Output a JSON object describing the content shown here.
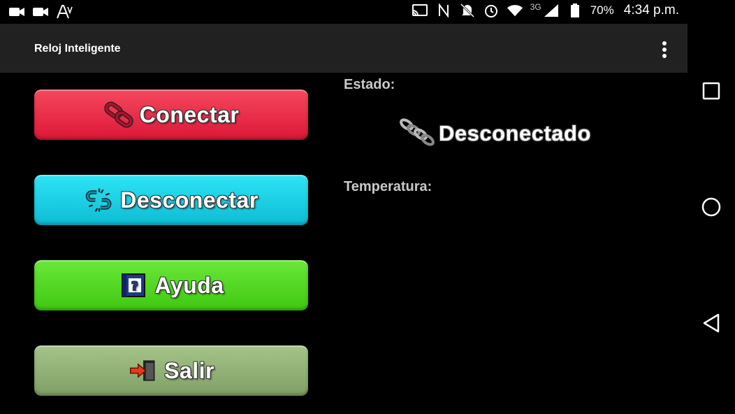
{
  "status_bar": {
    "icons_left": [
      "video-icon",
      "video-icon",
      "text-accessibility-icon"
    ],
    "icons_right": [
      "cast-icon",
      "nfc-icon",
      "mute-icon",
      "alarm-icon",
      "wifi-icon",
      "signal-icon",
      "battery-icon"
    ],
    "network": "3G",
    "battery": "70%",
    "time": "4:34 p.m."
  },
  "app_bar": {
    "title": "Reloj Inteligente"
  },
  "buttons": {
    "conectar": "Conectar",
    "desconectar": "Desconectar",
    "ayuda": "Ayuda",
    "salir": "Salir"
  },
  "panel": {
    "estado_label": "Estado:",
    "estado_value": "Desconectado",
    "temperatura_label": "Temperatura:"
  },
  "colors": {
    "conectar": "#e92a46",
    "desconectar": "#1bd0e5",
    "ayuda": "#52d824",
    "salir": "#93b277",
    "app_bar": "#212121"
  }
}
